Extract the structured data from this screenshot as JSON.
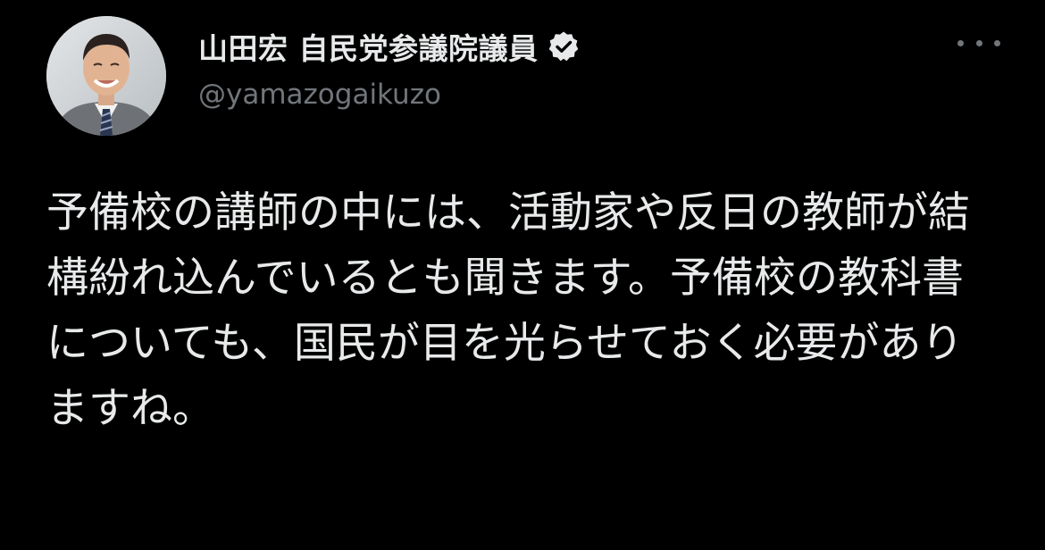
{
  "tweet": {
    "display_name": "山田宏 自民党参議院議員",
    "handle": "@yamazogaikuzo",
    "verified_icon": "verified-badge-icon",
    "more_icon": "more-options-icon",
    "text": "予備校の講師の中には、活動家や反日の教師が結構紛れ込んでいるとも聞きます。予備校の教科書についても、国民が目を光らせておく必要がありますね。"
  },
  "colors": {
    "background": "#000000",
    "text_primary": "#e7e9ea",
    "text_secondary": "#71767b",
    "badge": "#e7e9ea"
  }
}
